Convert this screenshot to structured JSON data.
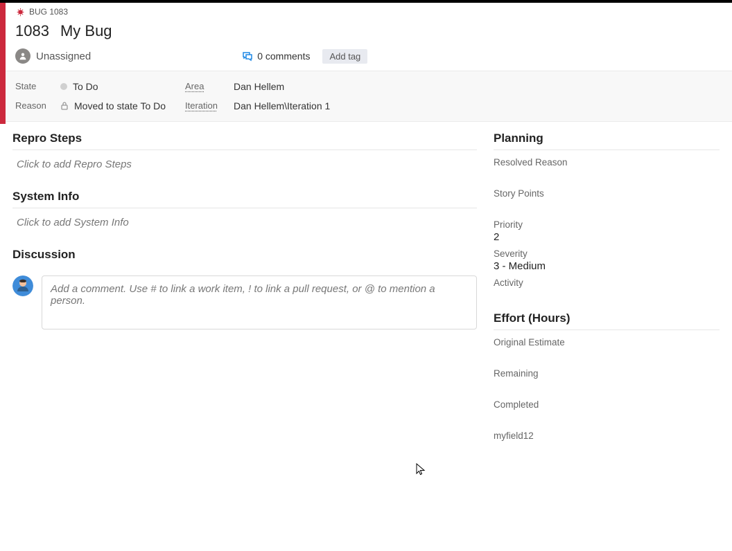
{
  "breadcrumb": {
    "label": "BUG 1083"
  },
  "workitem": {
    "id": "1083",
    "title": "My Bug",
    "assignee": "Unassigned",
    "comments": "0 comments",
    "add_tag": "Add tag"
  },
  "classification": {
    "state_label": "State",
    "state_value": "To Do",
    "reason_label": "Reason",
    "reason_value": "Moved to state To Do",
    "area_label": "Area",
    "area_value": "Dan Hellem",
    "iteration_label": "Iteration",
    "iteration_value": "Dan Hellem\\Iteration 1"
  },
  "sections": {
    "repro_title": "Repro Steps",
    "repro_placeholder": "Click to add Repro Steps",
    "sysinfo_title": "System Info",
    "sysinfo_placeholder": "Click to add System Info",
    "discussion_title": "Discussion",
    "discussion_placeholder": "Add a comment. Use # to link a work item, ! to link a pull request, or @ to mention a person."
  },
  "planning": {
    "title": "Planning",
    "resolved_reason": "Resolved Reason",
    "story_points": "Story Points",
    "priority_label": "Priority",
    "priority_value": "2",
    "severity_label": "Severity",
    "severity_value": "3 - Medium",
    "activity_label": "Activity"
  },
  "effort": {
    "title": "Effort (Hours)",
    "original": "Original Estimate",
    "remaining": "Remaining",
    "completed": "Completed",
    "custom": "myfield12"
  }
}
